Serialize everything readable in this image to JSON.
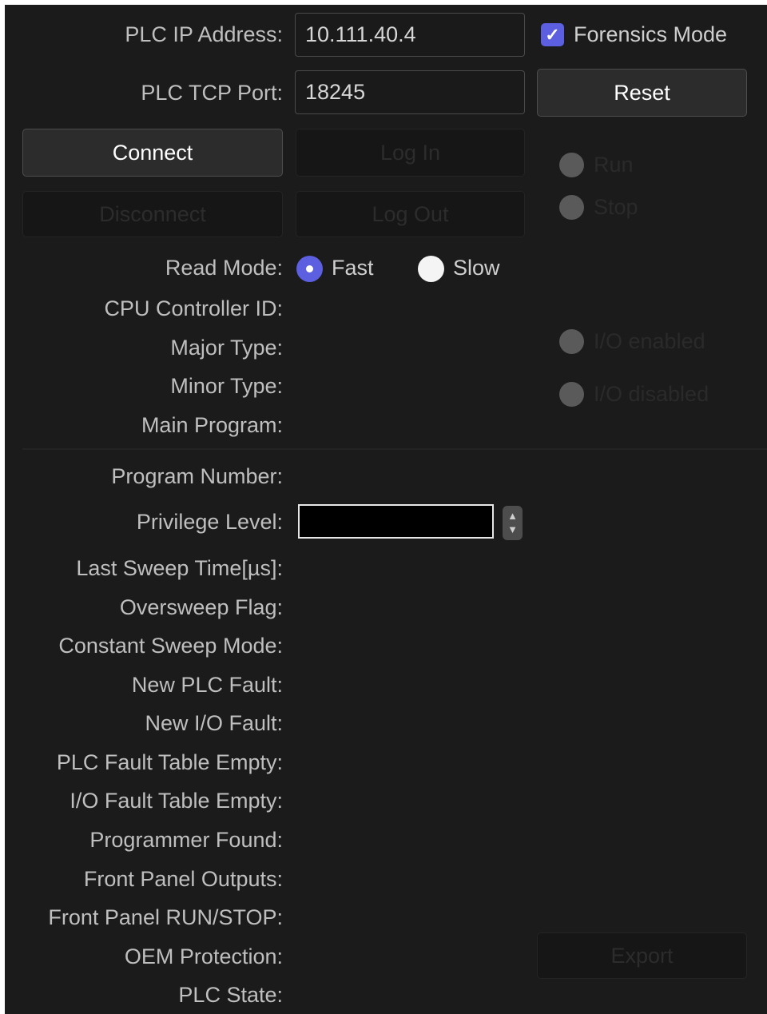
{
  "connection": {
    "ip_label": "PLC IP Address:",
    "ip_value": "10.111.40.4",
    "port_label": "PLC TCP Port:",
    "port_value": "18245",
    "forensics_label": "Forensics Mode",
    "forensics_checked": true,
    "reset_label": "Reset",
    "connect_label": "Connect",
    "login_label": "Log In",
    "disconnect_label": "Disconnect",
    "logout_label": "Log Out"
  },
  "run_control": {
    "run_label": "Run",
    "stop_label": "Stop",
    "io_enabled_label": "I/O enabled",
    "io_disabled_label": "I/O disabled"
  },
  "read_mode": {
    "label": "Read Mode:",
    "options": [
      "Fast",
      "Slow"
    ],
    "selected": "Fast"
  },
  "info": {
    "cpu_controller_id": "CPU Controller ID:",
    "major_type": "Major Type:",
    "minor_type": "Minor Type:",
    "main_program": "Main Program:"
  },
  "status": {
    "program_number": "Program Number:",
    "privilege_level": "Privilege Level:",
    "last_sweep_time": "Last Sweep Time[µs]:",
    "oversweep_flag": "Oversweep Flag:",
    "constant_sweep_mode": "Constant Sweep Mode:",
    "new_plc_fault": "New PLC Fault:",
    "new_io_fault": "New I/O Fault:",
    "plc_fault_table_empty": "PLC Fault Table Empty:",
    "io_fault_table_empty": "I/O Fault Table Empty:",
    "programmer_found": "Programmer Found:",
    "front_panel_outputs": "Front Panel Outputs:",
    "front_panel_run_stop": "Front Panel RUN/STOP:",
    "oem_protection": "OEM Protection:",
    "plc_state": "PLC State:"
  },
  "export_label": "Export",
  "colors": {
    "background": "#1b1b1b",
    "accent": "#5b5fe0",
    "label_text": "#bfbfbf"
  }
}
